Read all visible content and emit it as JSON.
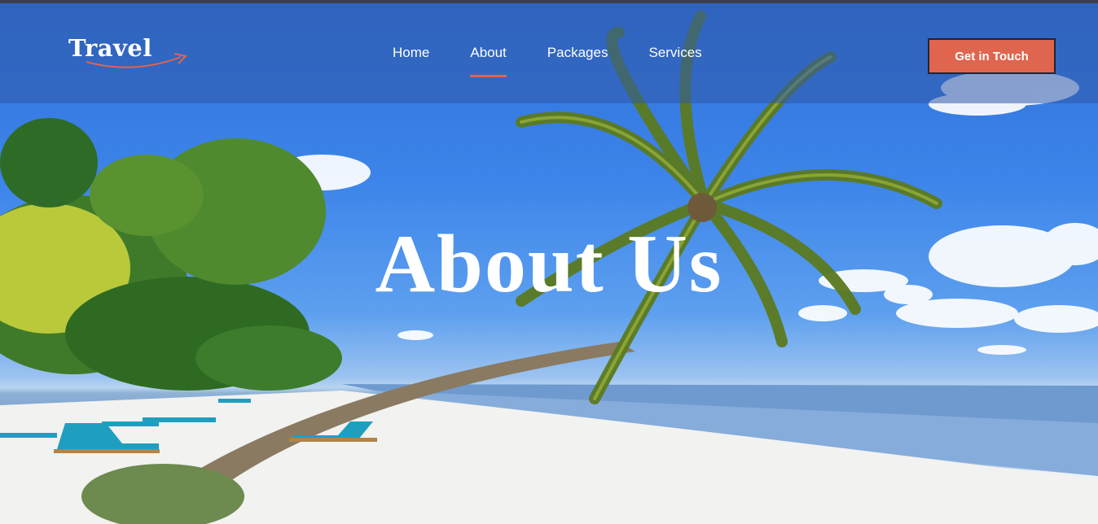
{
  "logo": {
    "text": "Travel"
  },
  "nav": {
    "items": [
      {
        "label": "Home",
        "active": false
      },
      {
        "label": "About",
        "active": true
      },
      {
        "label": "Packages",
        "active": false
      },
      {
        "label": "Services",
        "active": false
      }
    ]
  },
  "header": {
    "cta_label": "Get in Touch"
  },
  "hero": {
    "title": "About Us"
  },
  "colors": {
    "accent": "#e0654e",
    "header_overlay": "#2f59aa",
    "sky": "#3d85ea",
    "sand": "#f4f4f4",
    "sea": "#7aa4d6"
  }
}
